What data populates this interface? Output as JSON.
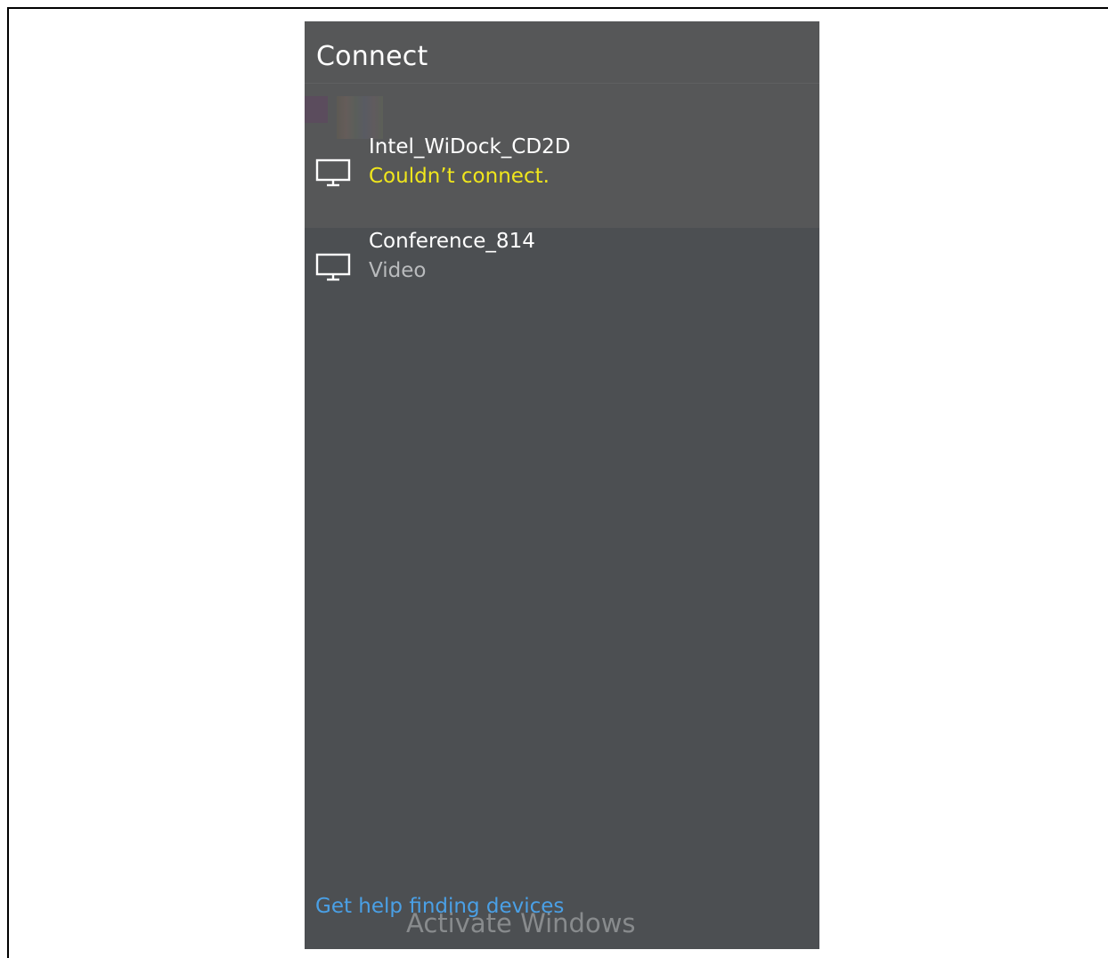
{
  "connect_pane": {
    "title": "Connect",
    "devices": [
      {
        "name": "Intel_WiDock_CD2D",
        "status": "Couldn’t connect.",
        "icon": "monitor-icon"
      },
      {
        "name": "Conference_814",
        "status": "Video",
        "icon": "monitor-icon"
      }
    ],
    "help_link": "Get help finding devices"
  },
  "watermark": "Activate Windows",
  "colors": {
    "panel_background": "#4c4f52",
    "error_status": "#f0e61c",
    "link": "#4aa0e6"
  }
}
